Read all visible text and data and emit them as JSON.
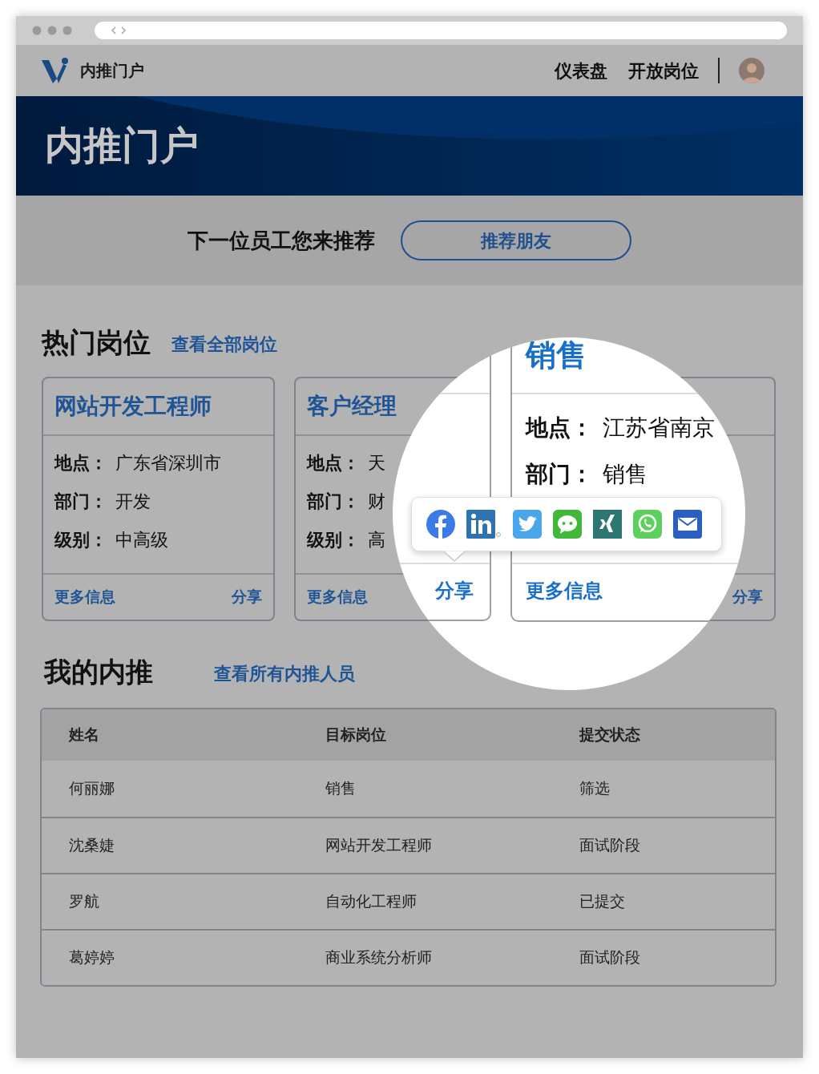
{
  "nav": {
    "brand": "内推门户",
    "links": [
      {
        "label": "仪表盘"
      },
      {
        "label": "开放岗位"
      }
    ]
  },
  "hero": {
    "title": "内推门户"
  },
  "cta": {
    "text": "下一位员工您来推荐",
    "button": "推荐朋友"
  },
  "jobs": {
    "heading": "热门岗位",
    "link": "查看全部岗位",
    "cards": [
      {
        "title": "网站开发工程师",
        "fields": [
          {
            "label": "地点：",
            "value": "广东省深圳市"
          },
          {
            "label": "部门：",
            "value": "开发"
          },
          {
            "label": "级别：",
            "value": "中高级"
          }
        ],
        "more": "更多信息",
        "share": "分享"
      },
      {
        "title": "客户经理",
        "fields": [
          {
            "label": "地点：",
            "value": "天"
          },
          {
            "label": "部门：",
            "value": "财"
          },
          {
            "label": "级别：",
            "value": "高"
          }
        ],
        "more": "更多信息"
      },
      {
        "share": "分享"
      }
    ]
  },
  "magnifier": {
    "left_card": {
      "share": "分享"
    },
    "right_card": {
      "title": "销售",
      "fields": [
        {
          "label": "地点：",
          "value": "江苏省南京"
        },
        {
          "label": "部门：",
          "value": "销售"
        }
      ],
      "more": "更多信息"
    }
  },
  "referrals": {
    "heading": "我的内推",
    "link": "查看所有内推人员",
    "columns": [
      "姓名",
      "目标岗位",
      "提交状态"
    ],
    "rows": [
      [
        "何丽娜",
        "销售",
        "筛选"
      ],
      [
        "沈桑婕",
        "网站开发工程师",
        "面试阶段"
      ],
      [
        "罗航",
        "自动化工程师",
        "已提交"
      ],
      [
        "葛婷婷",
        "商业系统分析师",
        "面试阶段"
      ]
    ]
  }
}
